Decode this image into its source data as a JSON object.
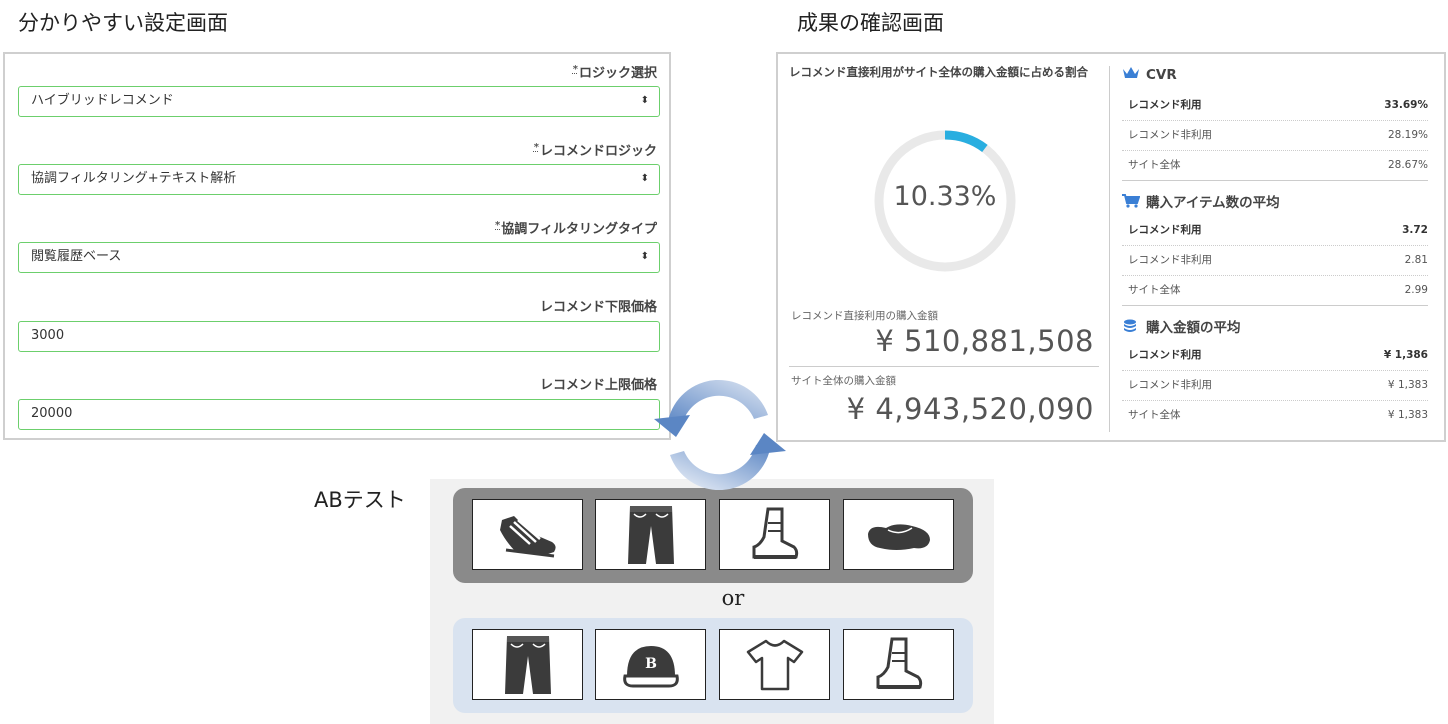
{
  "settings": {
    "title": "分かりやすい設定画面",
    "fields": [
      {
        "label": "ロジック選択",
        "required": true,
        "value": "ハイブリッドレコメンド",
        "type": "select"
      },
      {
        "label": "レコメンドロジック",
        "required": true,
        "value": "協調フィルタリング+テキスト解析",
        "type": "select"
      },
      {
        "label": "協調フィルタリングタイプ",
        "required": true,
        "value": "閲覧履歴ベース",
        "type": "select"
      },
      {
        "label": "レコメンド下限価格",
        "required": false,
        "value": "3000",
        "type": "input"
      },
      {
        "label": "レコメンド上限価格",
        "required": false,
        "value": "20000",
        "type": "input"
      }
    ],
    "required_mark": "*",
    "select_arrows": "⬍"
  },
  "results": {
    "title": "成果の確認画面",
    "donut": {
      "title": "レコメンド直接利用がサイト全体の購入金額に占める割合",
      "value_text": "10.33%",
      "fraction": 0.1033,
      "track_color": "#e9e9e9",
      "arc_color": "#29aee0"
    },
    "amounts": [
      {
        "label": "レコメンド直接利用の購入金額",
        "value": "¥ 510,881,508"
      },
      {
        "label": "サイト全体の購入金額",
        "value": "¥ 4,943,520,090"
      }
    ],
    "sections": [
      {
        "icon": "crown-icon",
        "title": "CVR",
        "rows": [
          {
            "label": "レコメンド利用",
            "value": "33.69%",
            "bold": true
          },
          {
            "label": "レコメンド非利用",
            "value": "28.19%",
            "bold": false
          },
          {
            "label": "サイト全体",
            "value": "28.67%",
            "bold": false
          }
        ]
      },
      {
        "icon": "cart-icon",
        "title": "購入アイテム数の平均",
        "rows": [
          {
            "label": "レコメンド利用",
            "value": "3.72",
            "bold": true
          },
          {
            "label": "レコメンド非利用",
            "value": "2.81",
            "bold": false
          },
          {
            "label": "サイト全体",
            "value": "2.99",
            "bold": false
          }
        ]
      },
      {
        "icon": "coins-icon",
        "title": "購入金額の平均",
        "rows": [
          {
            "label": "レコメンド利用",
            "value": "¥ 1,386",
            "bold": true
          },
          {
            "label": "レコメンド非利用",
            "value": "¥ 1,383",
            "bold": false
          },
          {
            "label": "サイト全体",
            "value": "¥ 1,383",
            "bold": false
          }
        ]
      }
    ]
  },
  "ab_test": {
    "label": "ABテスト",
    "or_text": "or",
    "group_a": [
      "sneaker-icon",
      "jeans-icon",
      "boot-icon",
      "loafer-icon"
    ],
    "group_b": [
      "jeans-icon",
      "cap-icon",
      "tshirt-icon",
      "boot-icon"
    ],
    "cap_letter": "B"
  },
  "colors": {
    "field_border": "#6ccf6c",
    "icon_blue": "#3a7fd5",
    "cycle_dark": "#5b86c4",
    "cycle_light": "#dfe7f3"
  }
}
